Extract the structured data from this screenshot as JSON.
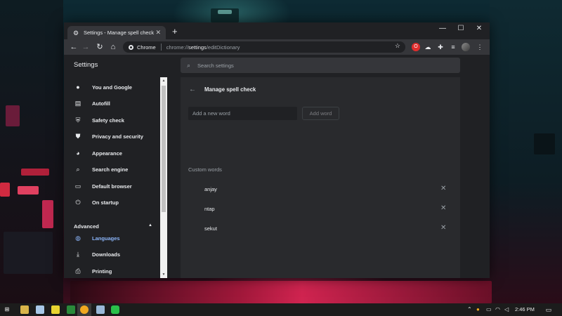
{
  "browser": {
    "tab_title": "Settings - Manage spell check",
    "new_tab": "+",
    "site_chip": "Chrome",
    "url_prefix": "chrome://",
    "url_bold": "settings",
    "url_suffix": "/editDictionary"
  },
  "settings": {
    "title": "Settings",
    "search_placeholder": "Search settings",
    "sidebar": {
      "items": [
        {
          "label": "You and Google",
          "icon": "person-icon"
        },
        {
          "label": "Autofill",
          "icon": "clipboard-icon"
        },
        {
          "label": "Safety check",
          "icon": "shield-check-icon"
        },
        {
          "label": "Privacy and security",
          "icon": "shield-icon"
        },
        {
          "label": "Appearance",
          "icon": "palette-icon"
        },
        {
          "label": "Search engine",
          "icon": "search-icon"
        },
        {
          "label": "Default browser",
          "icon": "browser-window-icon"
        },
        {
          "label": "On startup",
          "icon": "power-icon"
        }
      ],
      "advanced_label": "Advanced",
      "advanced_items": [
        {
          "label": "Languages",
          "icon": "globe-icon",
          "active": true
        },
        {
          "label": "Downloads",
          "icon": "download-icon"
        },
        {
          "label": "Printing",
          "icon": "printer-icon"
        }
      ]
    },
    "page": {
      "title": "Manage spell check",
      "input_placeholder": "Add a new word",
      "add_button": "Add word",
      "custom_words_label": "Custom words",
      "words": [
        "anjay",
        "ntap",
        "sekut"
      ]
    }
  },
  "taskbar": {
    "time": "2:46 PM"
  },
  "colors": {
    "accent": "#8ab4f8",
    "background": "#202124",
    "card": "#292a2d"
  }
}
